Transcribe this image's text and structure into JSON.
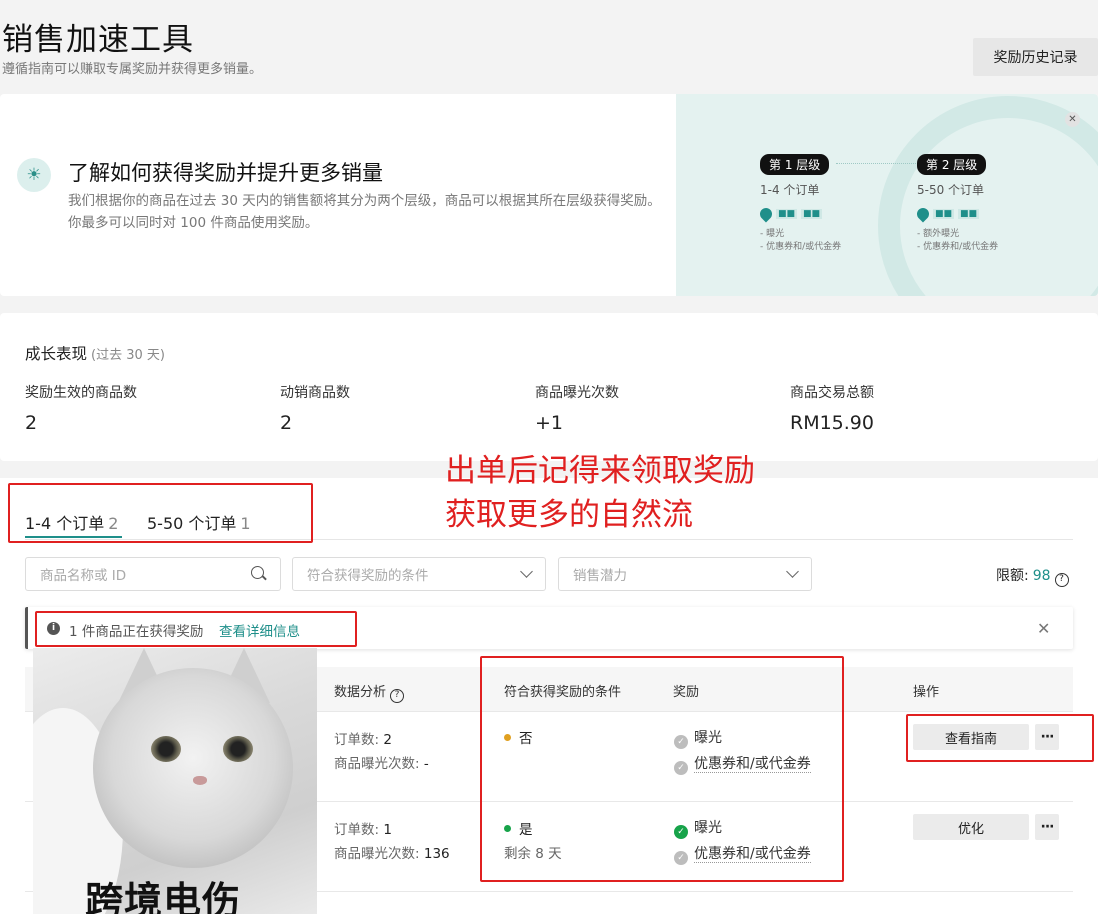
{
  "header": {
    "title": "销售加速工具",
    "subtitle": "遵循指南可以赚取专属奖励并获得更多销量。",
    "history_button": "奖励历史记录"
  },
  "promo": {
    "icon": "lightbulb-icon",
    "title": "了解如何获得奖励并提升更多销量",
    "description": "我们根据你的商品在过去 30 天内的销售额将其分为两个层级，商品可以根据其所在层级获得奖励。你最多可以同时对 100 件商品使用奖励。",
    "close_icon": "close-icon",
    "tiers": [
      {
        "badge": "第 1 层级",
        "range": "1-4 个订单",
        "features": [
          "- 曝光",
          "- 优惠券和/或代金券"
        ]
      },
      {
        "badge": "第 2 层级",
        "range": "5-50 个订单",
        "features": [
          "- 额外曝光",
          "- 优惠券和/或代金券"
        ]
      }
    ]
  },
  "growth": {
    "title": "成长表现",
    "period": "(过去 30 天)",
    "metrics": [
      {
        "label": "奖励生效的商品数",
        "value": "2"
      },
      {
        "label": "动销商品数",
        "value": "2"
      },
      {
        "label": "商品曝光次数",
        "value": "+1"
      },
      {
        "label": "商品交易总额",
        "value": "RM15.90"
      }
    ]
  },
  "annotation": {
    "line1": "出单后记得来领取奖励",
    "line2": "获取更多的自然流"
  },
  "tabs": [
    {
      "label": "1-4 个订单",
      "count": "2"
    },
    {
      "label": "5-50 个订单",
      "count": "1"
    }
  ],
  "filters": {
    "search_placeholder": "商品名称或 ID",
    "condition_placeholder": "符合获得奖励的条件",
    "potential_placeholder": "销售潜力",
    "quota_label": "限额:",
    "quota_value": "98"
  },
  "notice": {
    "text": "1 件商品正在获得奖励",
    "link": "查看详细信息"
  },
  "table": {
    "headers": {
      "analysis": "数据分析",
      "condition": "符合获得奖励的条件",
      "reward": "奖励",
      "action": "操作"
    },
    "rows": [
      {
        "orders_label": "订单数:",
        "orders": "2",
        "views_label": "商品曝光次数:",
        "views": "-",
        "eligible": "否",
        "eligible_color": "#e0a020",
        "remaining": "",
        "reward_exposure": "曝光",
        "reward_coupon": "优惠券和/或代金券",
        "exposure_active": false,
        "action": "查看指南"
      },
      {
        "orders_label": "订单数:",
        "orders": "1",
        "views_label": "商品曝光次数:",
        "views": "136",
        "eligible": "是",
        "eligible_color": "#17a34a",
        "remaining": "剩余 8 天",
        "reward_exposure": "曝光",
        "reward_coupon": "优惠券和/或代金券",
        "exposure_active": true,
        "action": "优化"
      }
    ]
  },
  "meme": {
    "caption": "跨境电伤"
  }
}
